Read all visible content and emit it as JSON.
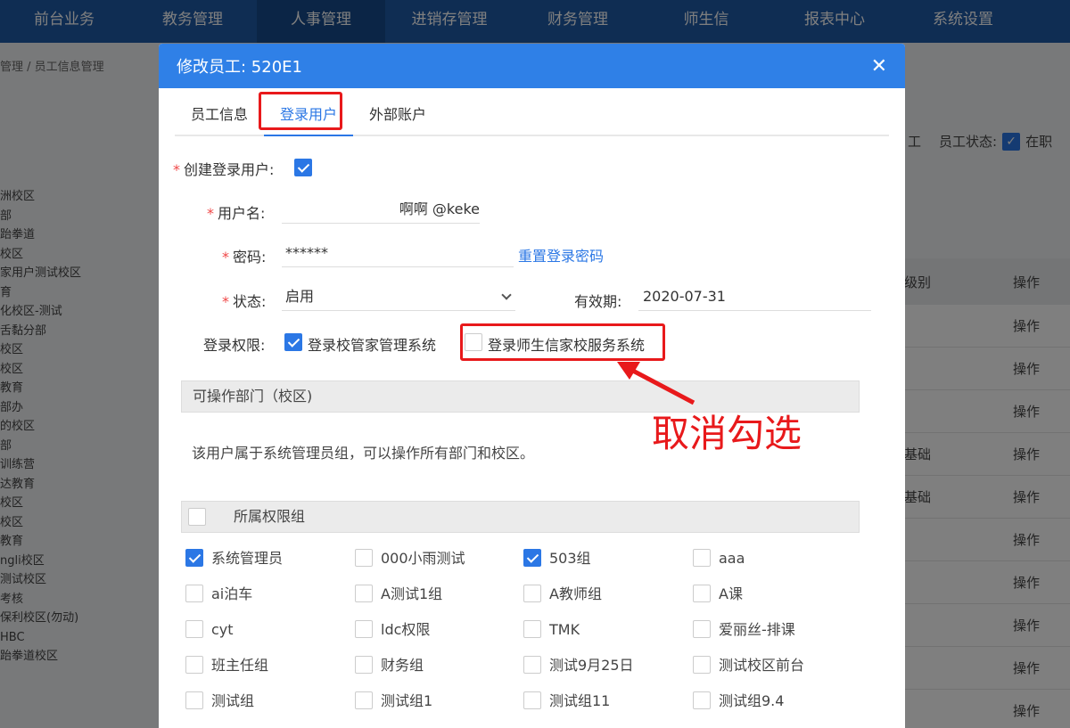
{
  "nav": [
    "前台业务",
    "教务管理",
    "人事管理",
    "进销存管理",
    "财务管理",
    "师生信",
    "报表中心",
    "系统设置"
  ],
  "background": {
    "breadcrumb": "管理 / 员工信息管理",
    "left_items": [
      "洲校区",
      "部",
      "跆拳道",
      "校区",
      "家用户测试校区",
      "育",
      "化校区-测试",
      "舌黏分部",
      "校区",
      "校区",
      "教育",
      "部办",
      "的校区",
      "部",
      "训练营",
      "达教育",
      "",
      "校区",
      "校区",
      "教育",
      "ngli校区",
      "测试校区",
      "考核",
      "保利校区(勿动)",
      "HBC",
      "跆拳道校区"
    ],
    "status_text_1": "工",
    "status_label": "员工状态:",
    "status_value": "在职",
    "table_header": "级别",
    "table_action": "操作",
    "rows": [
      {
        "c1": "",
        "c2": "操作"
      },
      {
        "c1": "",
        "c2": "操作"
      },
      {
        "c1": "",
        "c2": "操作"
      },
      {
        "c1": "基础",
        "c2": "操作"
      },
      {
        "c1": "基础",
        "c2": "操作"
      },
      {
        "c1": "",
        "c2": "操作"
      },
      {
        "c1": "",
        "c2": "操作"
      },
      {
        "c1": "",
        "c2": "操作"
      },
      {
        "c1": "",
        "c2": "操作"
      },
      {
        "c1": "",
        "c2": "操作"
      }
    ]
  },
  "modal": {
    "title": "修改员工: 520E1",
    "tabs": [
      "员工信息",
      "登录用户",
      "外部账户"
    ],
    "create_user_label": "创建登录用户:",
    "username_label": "用户名:",
    "username_value": "啊啊 @keke",
    "password_label": "密码:",
    "password_value": "******",
    "reset_password": "重置登录密码",
    "status_label": "状态:",
    "status_value": "启用",
    "expiry_label": "有效期:",
    "expiry_value": "2020-07-31",
    "permission_label": "登录权限:",
    "perm_option_1": "登录校管家管理系统",
    "perm_option_2": "登录师生信家校服务系统",
    "dept_section": "可操作部门（校区)",
    "dept_desc": "该用户属于系统管理员组，可以操作所有部门和校区。",
    "group_section": "所属权限组",
    "groups": [
      [
        "系统管理员",
        "000小雨测试",
        "503组",
        "aaa"
      ],
      [
        "ai泊车",
        "A测试1组",
        "A教师组",
        "A课"
      ],
      [
        "cyt",
        "ldc权限",
        "TMK",
        "爱丽丝-排课"
      ],
      [
        "班主任组",
        "财务组",
        "测试9月25日",
        "测试校区前台"
      ],
      [
        "测试组",
        "测试组1",
        "测试组11",
        "测试组9.4"
      ]
    ],
    "checked_groups": [
      "系统管理员",
      "503组"
    ]
  },
  "annotation": "取消勾选",
  "colors": {
    "primary": "#2f80e7",
    "nav": "#1f5aa6",
    "annotation": "#e8191b"
  }
}
